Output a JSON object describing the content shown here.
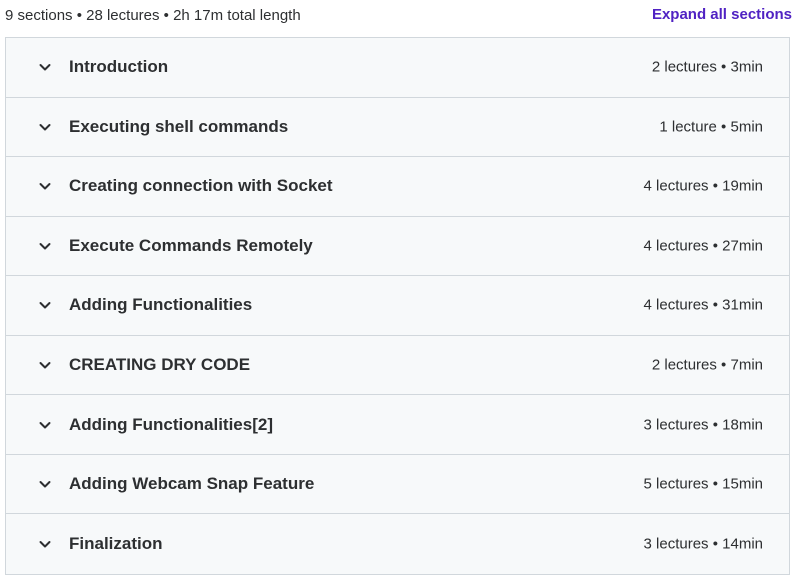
{
  "header": {
    "summary": "9 sections • 28 lectures • 2h 17m total length",
    "expand_all_label": "Expand all sections"
  },
  "sections": [
    {
      "title": "Introduction",
      "meta": "2 lectures • 3min",
      "icon": "chevron-down-icon"
    },
    {
      "title": "Executing shell commands",
      "meta": "1 lecture • 5min",
      "icon": "chevron-down-icon"
    },
    {
      "title": "Creating connection with Socket",
      "meta": "4 lectures • 19min",
      "icon": "chevron-down-icon"
    },
    {
      "title": "Execute Commands Remotely",
      "meta": "4 lectures • 27min",
      "icon": "chevron-down-icon"
    },
    {
      "title": "Adding Functionalities",
      "meta": "4 lectures • 31min",
      "icon": "chevron-down-icon"
    },
    {
      "title": "CREATING DRY CODE",
      "meta": "2 lectures • 7min",
      "icon": "chevron-down-icon"
    },
    {
      "title": "Adding Functionalities[2]",
      "meta": "3 lectures • 18min",
      "icon": "chevron-down-icon"
    },
    {
      "title": "Adding Webcam Snap Feature",
      "meta": "5 lectures • 15min",
      "icon": "chevron-down-icon"
    },
    {
      "title": "Finalization",
      "meta": "3 lectures • 14min",
      "icon": "chevron-down-icon"
    }
  ],
  "colors": {
    "accent": "#5022c3",
    "text": "#2d2f31",
    "row_background": "#f7f9fa",
    "border": "#d1d7dc"
  }
}
